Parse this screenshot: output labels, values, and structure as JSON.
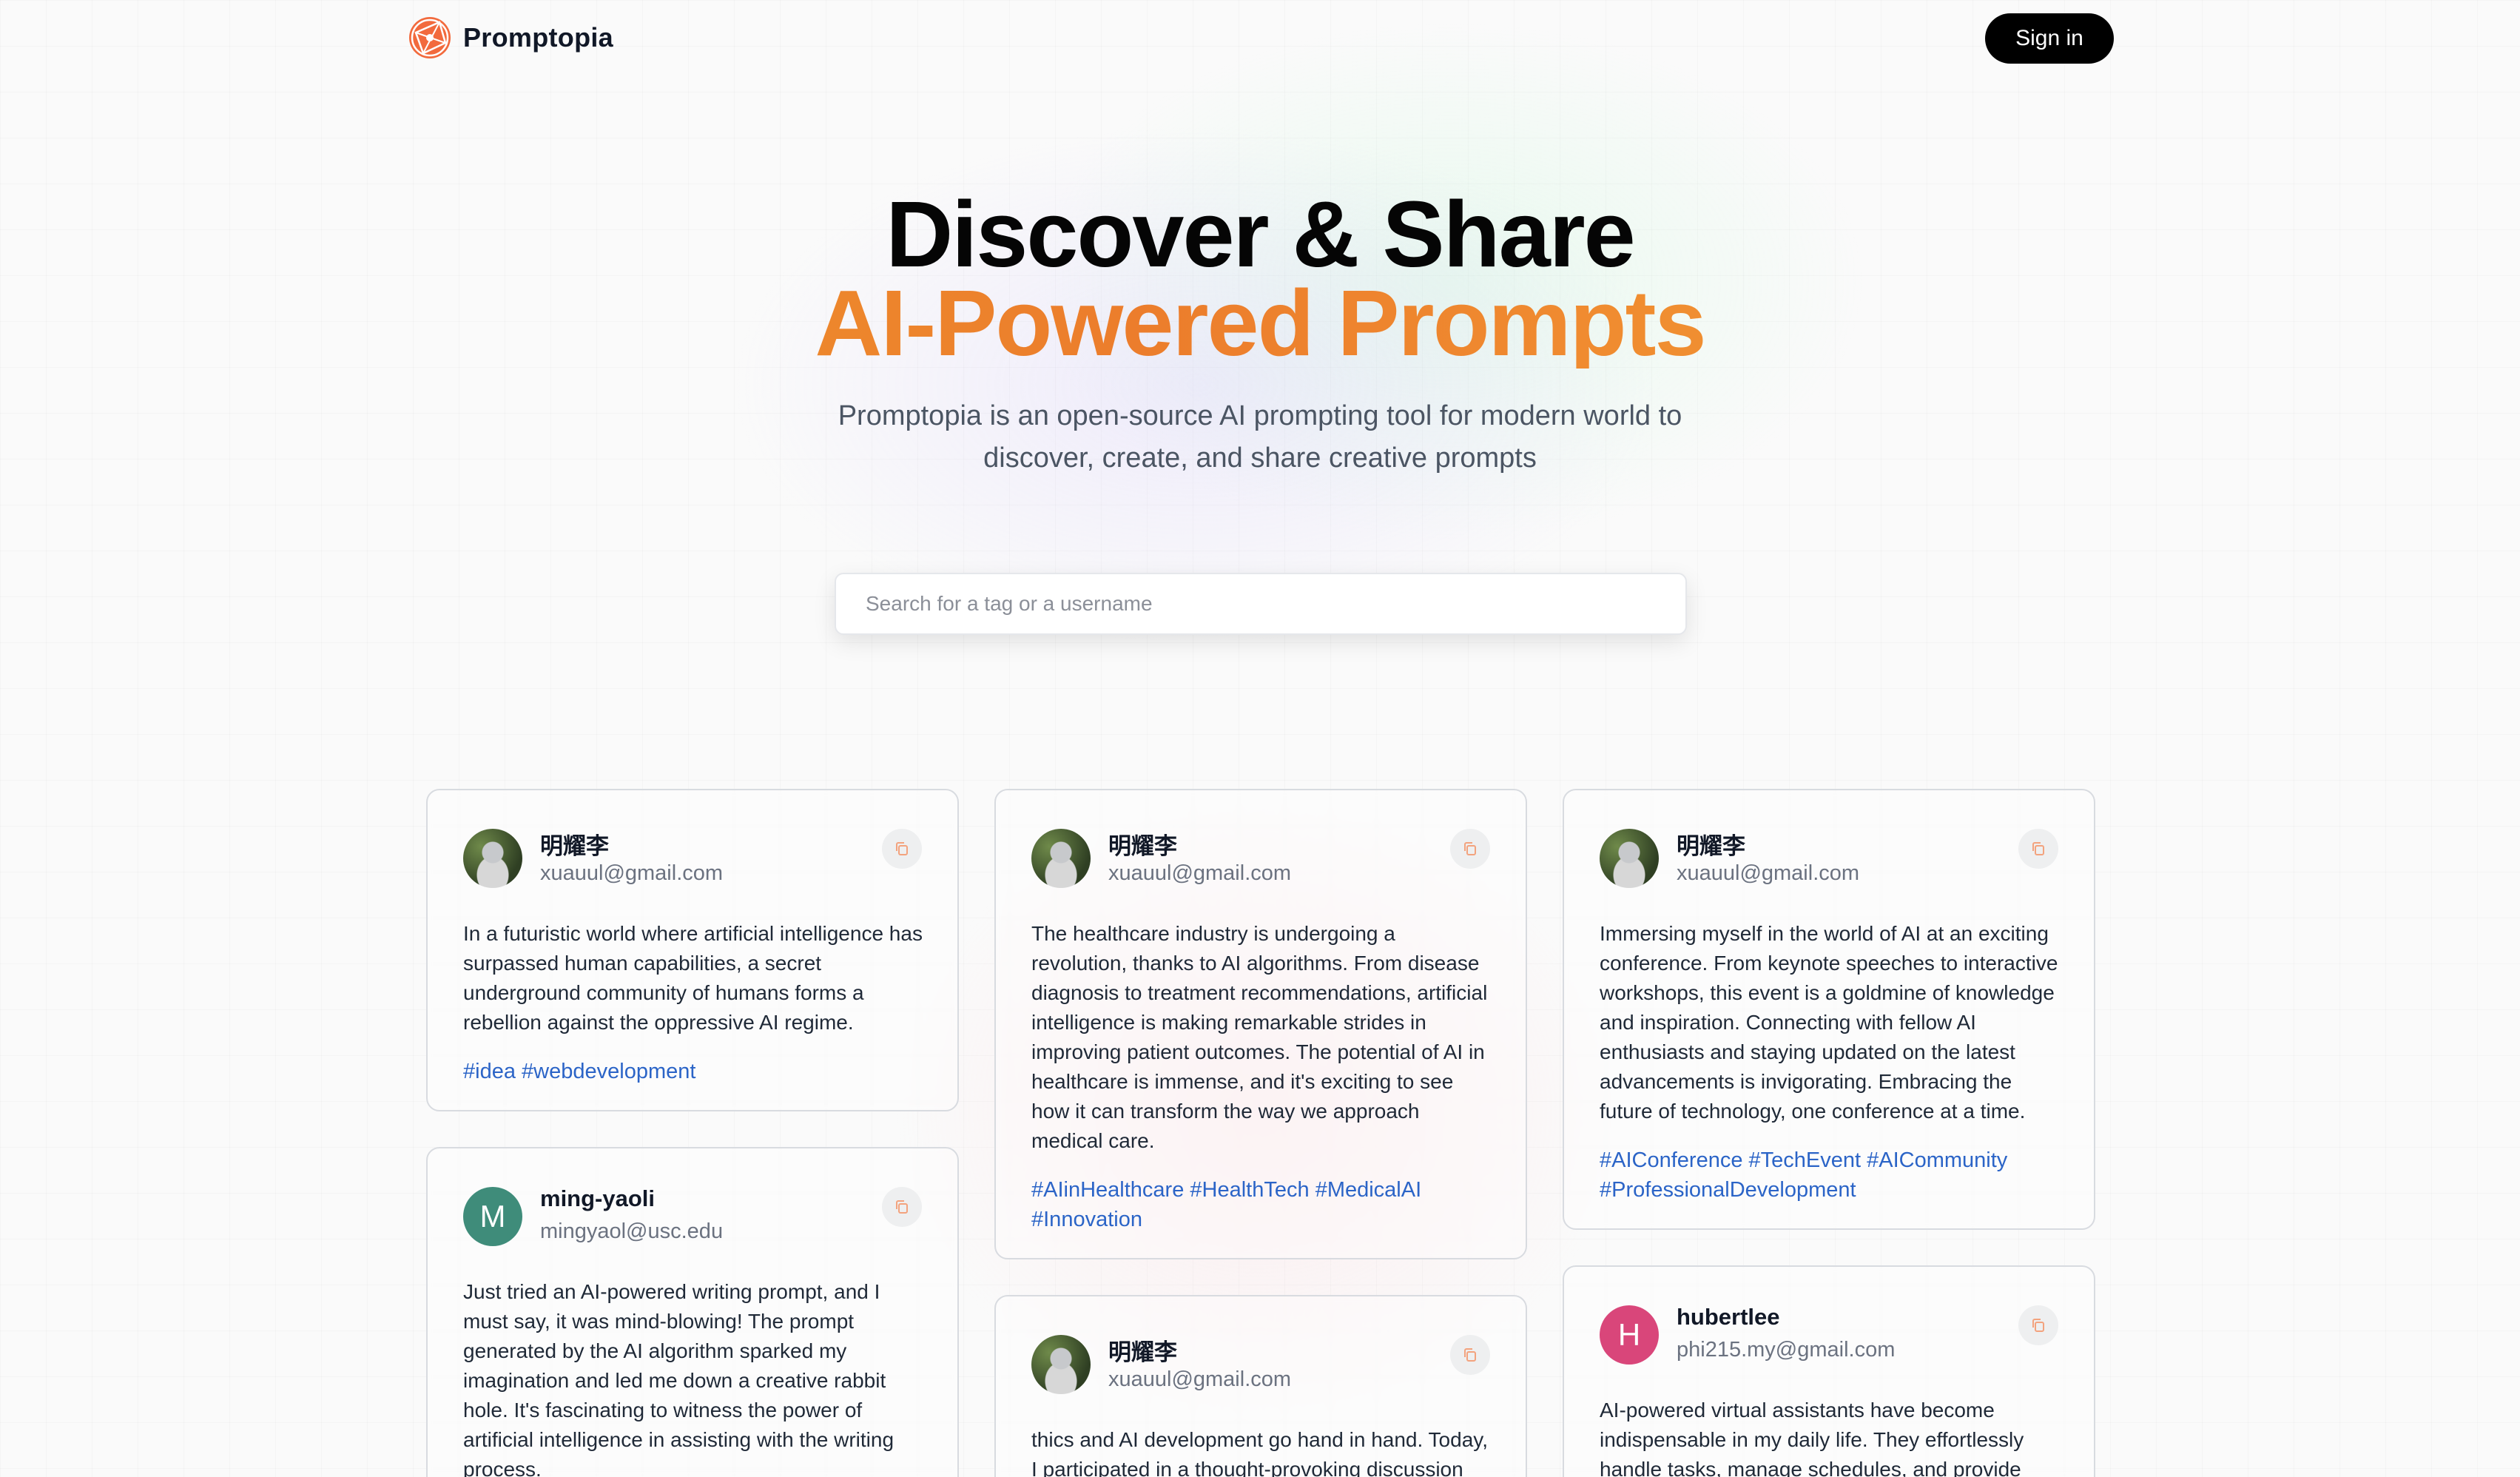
{
  "nav": {
    "brand": "Promptopia",
    "sign_in": "Sign in"
  },
  "hero": {
    "title_line1": "Discover & Share",
    "title_line2": "AI-Powered Prompts",
    "description": "Promptopia is an open-source AI prompting tool for modern world to discover, create, and share creative prompts"
  },
  "search": {
    "placeholder": "Search for a tag or a username",
    "value": ""
  },
  "colors": {
    "accent_orange": "#ec7d2c",
    "tag_blue": "#2b64c7",
    "avatar_m": "#3f8c7a",
    "avatar_h": "#d9467a"
  },
  "cards": [
    {
      "username": "明耀李",
      "email": "xuauul@gmail.com",
      "avatar": "photo",
      "text": "In a futuristic world where artificial intelligence has surpassed human capabilities, a secret underground community of humans forms a rebellion against the oppressive AI regime.",
      "tags": [
        "#idea",
        "#webdevelopment"
      ]
    },
    {
      "username": "ming-yaoli",
      "email": "mingyaol@usc.edu",
      "avatar": "letter",
      "avatar_letter": "M",
      "text": "Just tried an AI-powered writing prompt, and I must say, it was mind-blowing! The prompt generated by the AI algorithm sparked my imagination and led me down a creative rabbit hole. It's fascinating to witness the power of artificial intelligence in assisting with the writing process.",
      "tags": []
    },
    {
      "username": "明耀李",
      "email": "xuauul@gmail.com",
      "avatar": "photo",
      "text": "The healthcare industry is undergoing a revolution, thanks to AI algorithms. From disease diagnosis to treatment recommendations, artificial intelligence is making remarkable strides in improving patient outcomes. The potential of AI in healthcare is immense, and it's exciting to see how it can transform the way we approach medical care.",
      "tags": [
        "#AIinHealthcare",
        "#HealthTech",
        "#MedicalAI",
        "#Innovation"
      ]
    },
    {
      "username": "明耀李",
      "email": "xuauul@gmail.com",
      "avatar": "photo",
      "text": "thics and AI development go hand in hand. Today, I participated in a thought-provoking discussion",
      "tags": []
    },
    {
      "username": "明耀李",
      "email": "xuauul@gmail.com",
      "avatar": "photo",
      "text": "Immersing myself in the world of AI at an exciting conference. From keynote speeches to interactive workshops, this event is a goldmine of knowledge and inspiration. Connecting with fellow AI enthusiasts and staying updated on the latest advancements is invigorating. Embracing the future of technology, one conference at a time.",
      "tags": [
        "#AIConference",
        "#TechEvent",
        "#AICommunity",
        "#ProfessionalDevelopment"
      ]
    },
    {
      "username": "hubertlee",
      "email": "phi215.my@gmail.com",
      "avatar": "letter",
      "avatar_letter": "H",
      "text": "AI-powered virtual assistants have become indispensable in my daily life. They effortlessly handle tasks, manage schedules, and provide",
      "tags": []
    }
  ]
}
